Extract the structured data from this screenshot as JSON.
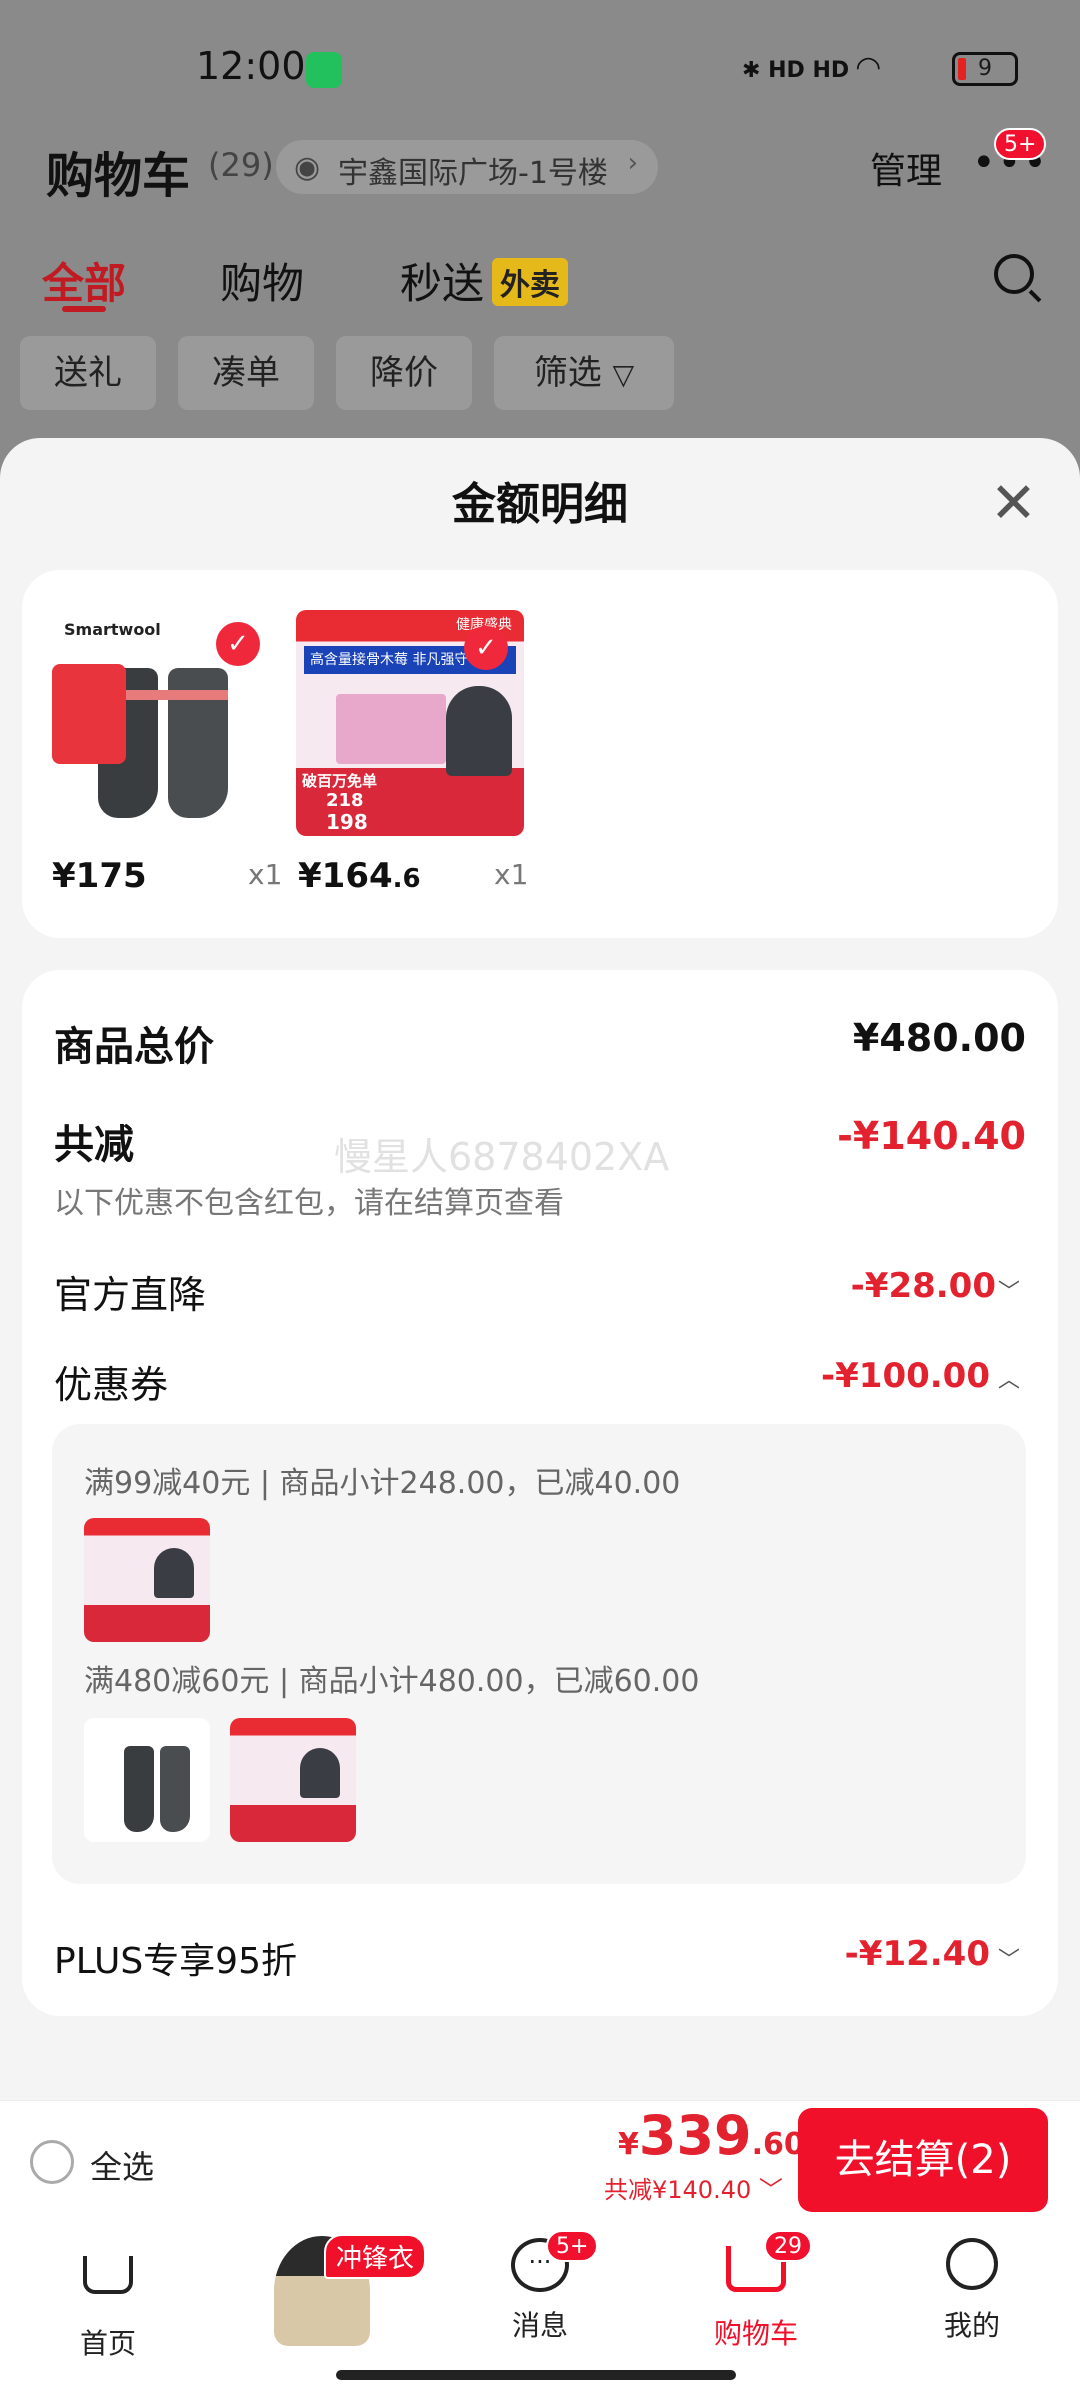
{
  "status_bar": {
    "time": "12:00",
    "signal": "HD HD",
    "battery": "9"
  },
  "header": {
    "title": "购物车",
    "count": "(29)",
    "address": "宇鑫国际广场-1号楼",
    "manage": "管理",
    "more_badge": "5+"
  },
  "tabs": [
    {
      "label": "全部"
    },
    {
      "label": "购物"
    },
    {
      "label": "秒送"
    }
  ],
  "tab_badge": "外卖",
  "chips": [
    {
      "label": "送礼"
    },
    {
      "label": "凑单"
    },
    {
      "label": "降价"
    },
    {
      "label": "筛选"
    }
  ],
  "sheet": {
    "title": "金额明细",
    "products": [
      {
        "brand": "Smartwool",
        "price": "¥175",
        "qty": "x1"
      },
      {
        "price_main": "¥164",
        "price_dec": ".6",
        "qty": "x1",
        "promo1": "高含量接骨木莓 非凡强守",
        "promo2": "健康盛典",
        "tag": "破百万免单",
        "p1": "218",
        "p2": "198"
      }
    ],
    "total_label": "商品总价",
    "total_value": "¥480.00",
    "reduce_label": "共减",
    "reduce_value": "-¥140.40",
    "reduce_note": "以下优惠不包含红包，请在结算页查看",
    "official_label": "官方直降",
    "official_value": "-¥28.00",
    "coupon_label": "优惠券",
    "coupon_value": "-¥100.00",
    "coupon_rules": [
      {
        "text": "满99减40元 | 商品小计248.00，已减40.00"
      },
      {
        "text": "满480减60元 | 商品小计480.00，已减60.00"
      }
    ],
    "plus_label": "PLUS专享95折",
    "plus_value": "-¥12.40",
    "watermark": "慢星人6878402XA"
  },
  "bottom_bar": {
    "select_all": "全选",
    "currency": "¥",
    "pay_int": "339",
    "pay_dec": ".60",
    "reduce_text": "共减¥140.40",
    "checkout": "去结算(2)"
  },
  "nav": [
    {
      "label": "首页"
    },
    {
      "label": "",
      "badge": "冲锋衣"
    },
    {
      "label": "消息",
      "badge": "5+"
    },
    {
      "label": "购物车",
      "badge": "29"
    },
    {
      "label": "我的"
    }
  ],
  "colors": {
    "accent": "#f1102a",
    "sheet_bg": "#f4f4f4",
    "dim_bg": "#8a8a8a"
  }
}
